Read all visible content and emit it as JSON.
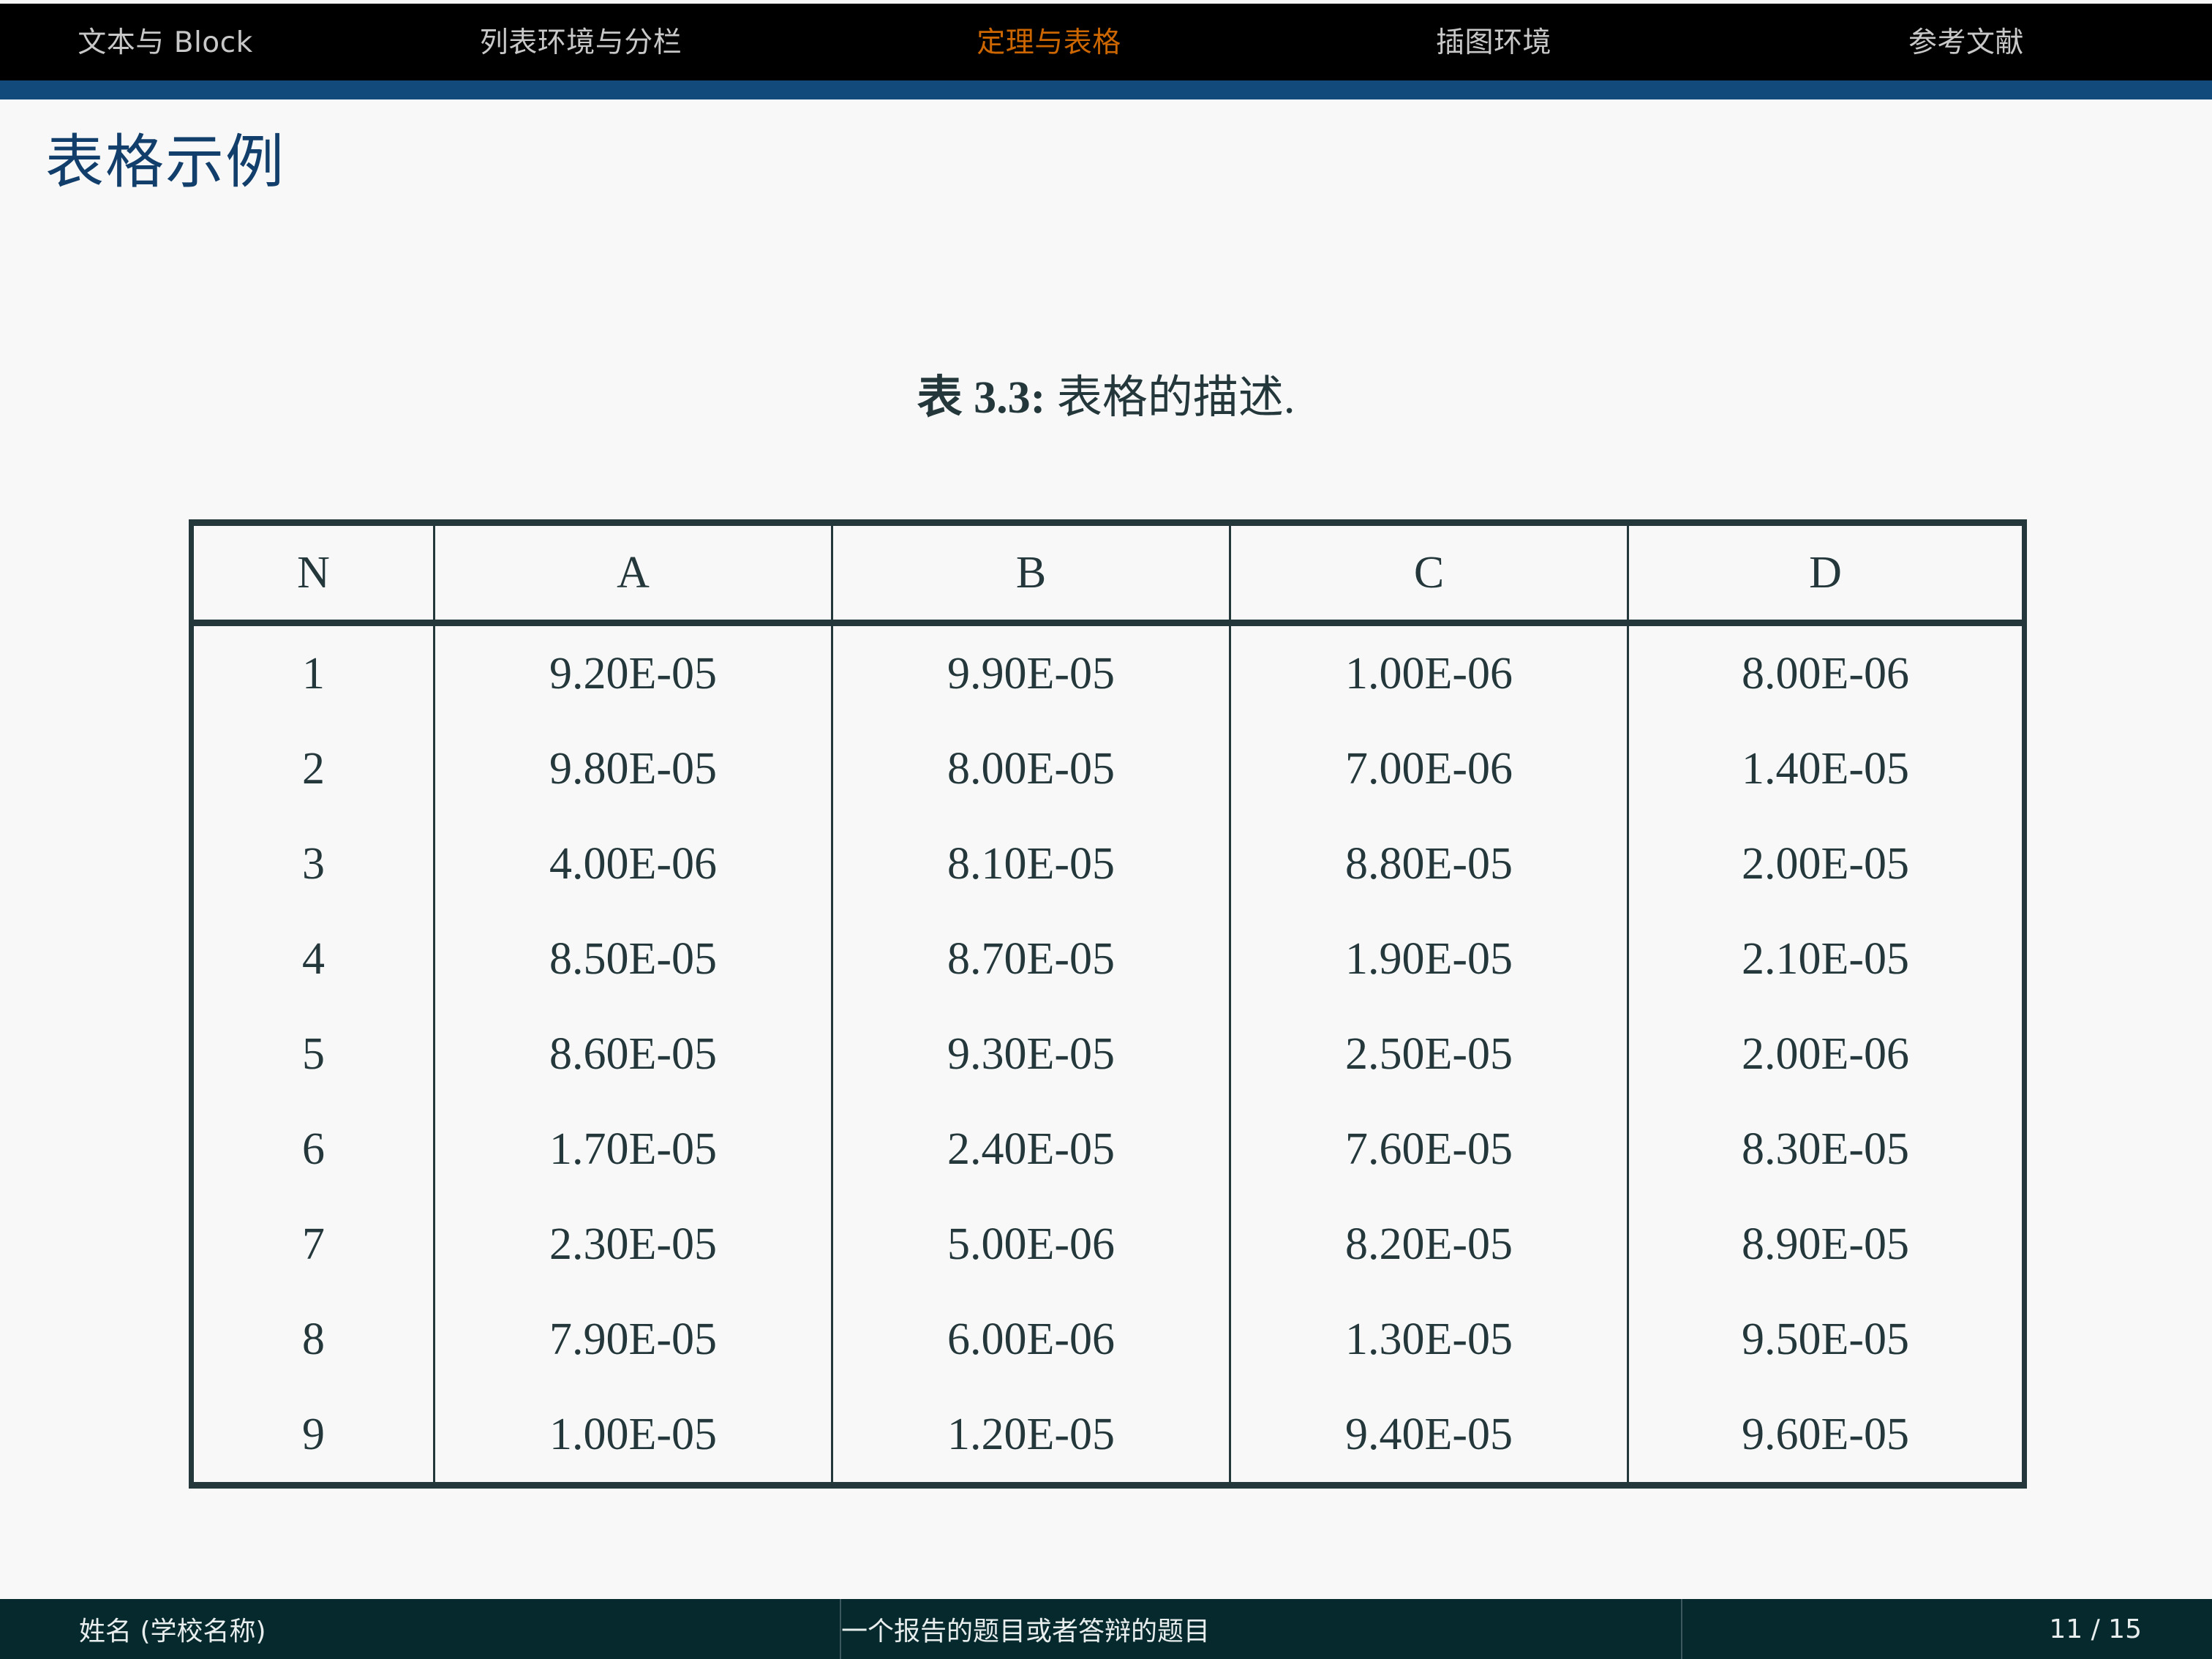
{
  "nav": {
    "items": [
      {
        "label": "文本与 Block",
        "active": false
      },
      {
        "label": "列表环境与分栏",
        "active": false
      },
      {
        "label": "定理与表格",
        "active": true
      },
      {
        "label": "插图环境",
        "active": false
      },
      {
        "label": "参考文献",
        "active": false
      }
    ],
    "accent_active_color": "#cc6600",
    "inactive_color": "#c8c8c8",
    "background_color": "#000000",
    "rule_color": "#134a7c"
  },
  "slide": {
    "title": "表格示例",
    "title_color": "#123e6b",
    "background_color": "#f8f8f8"
  },
  "table": {
    "caption_label": "表 3.3:",
    "caption_text": "表格的描述.",
    "headers": [
      "N",
      "A",
      "B",
      "C",
      "D"
    ],
    "rows": [
      [
        "1",
        "9.20E-05",
        "9.90E-05",
        "1.00E-06",
        "8.00E-06"
      ],
      [
        "2",
        "9.80E-05",
        "8.00E-05",
        "7.00E-06",
        "1.40E-05"
      ],
      [
        "3",
        "4.00E-06",
        "8.10E-05",
        "8.80E-05",
        "2.00E-05"
      ],
      [
        "4",
        "8.50E-05",
        "8.70E-05",
        "1.90E-05",
        "2.10E-05"
      ],
      [
        "5",
        "8.60E-05",
        "9.30E-05",
        "2.50E-05",
        "2.00E-06"
      ],
      [
        "6",
        "1.70E-05",
        "2.40E-05",
        "7.60E-05",
        "8.30E-05"
      ],
      [
        "7",
        "2.30E-05",
        "5.00E-06",
        "8.20E-05",
        "8.90E-05"
      ],
      [
        "8",
        "7.90E-05",
        "6.00E-06",
        "1.30E-05",
        "9.50E-05"
      ],
      [
        "9",
        "1.00E-05",
        "1.20E-05",
        "9.40E-05",
        "9.60E-05"
      ]
    ],
    "rule_color": "#24383c"
  },
  "footer": {
    "author": "姓名 (学校名称)",
    "title": "一个报告的题目或者答辩的题目",
    "page": "11 / 15",
    "background_color": "#06292d",
    "text_color": "#e8eded"
  }
}
